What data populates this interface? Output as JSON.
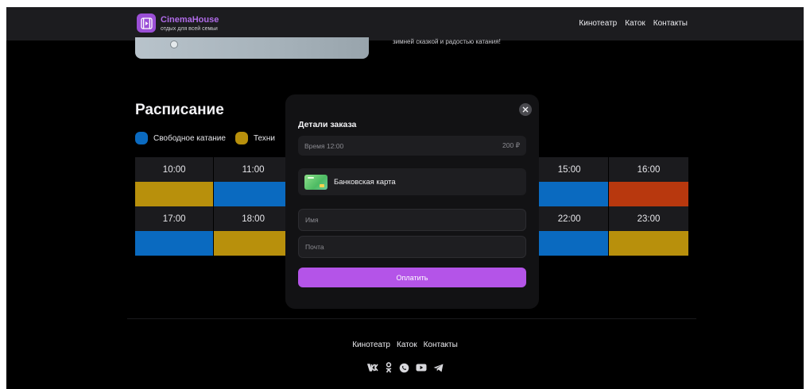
{
  "brand": {
    "name": "CinemaHouse",
    "tagline": "отдых для всей семьи"
  },
  "nav": [
    "Кинотеатр",
    "Каток",
    "Контакты"
  ],
  "hero": {
    "text_fragment": "зимней сказкой и радостью катания!"
  },
  "schedule": {
    "title": "Расписание",
    "legend": [
      {
        "label": "Свободное катание",
        "color": "#0a6ac0"
      },
      {
        "label": "Техни",
        "color": "#b8900c"
      }
    ],
    "rows": [
      {
        "times": [
          "10:00",
          "11:00",
          "",
          "",
          "",
          "15:00",
          "16:00"
        ],
        "colors": [
          "#b8900c",
          "#0a6ac0",
          "",
          "",
          "",
          "#0a6ac0",
          "#b8380e"
        ]
      },
      {
        "times": [
          "17:00",
          "18:00",
          "",
          "",
          "",
          "22:00",
          "23:00"
        ],
        "colors": [
          "#0a6ac0",
          "#b8900c",
          "",
          "",
          "",
          "#0a6ac0",
          "#b8900c"
        ]
      }
    ]
  },
  "modal": {
    "title": "Детали заказа",
    "order_time": "Время 12:00",
    "order_price": "200 ₽",
    "payment_method": "Банковская карта",
    "name_placeholder": "Имя",
    "email_placeholder": "Почта",
    "pay_button": "Оплатить"
  },
  "footer": {
    "nav": [
      "Кинотеатр",
      "Каток",
      "Контакты"
    ],
    "socials": [
      "vk-icon",
      "odnoklassniki-icon",
      "whatsapp-icon",
      "youtube-icon",
      "telegram-icon"
    ]
  },
  "colors": {
    "accent": "#b454e8",
    "free_skating": "#0a6ac0",
    "technical": "#b8900c",
    "busy": "#b8380e"
  }
}
